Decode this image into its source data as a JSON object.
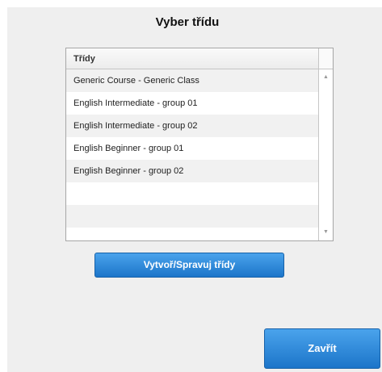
{
  "dialog": {
    "title": "Vyber třídu"
  },
  "class_list": {
    "header": "Třídy",
    "items": [
      "Generic Course - Generic Class",
      "English Intermediate - group 01",
      "English Intermediate - group 02",
      "English Beginner - group 01",
      "English Beginner - group 02",
      "",
      "",
      ""
    ]
  },
  "scrollbar": {
    "up_icon": "▲",
    "down_icon": "▼"
  },
  "buttons": {
    "manage_label": "Vytvoř/Spravuj třídy",
    "close_label": "Zavřít"
  },
  "colors": {
    "button_top": "#4aa3ec",
    "button_bottom": "#1c75c9",
    "panel_bg": "#efefef"
  }
}
